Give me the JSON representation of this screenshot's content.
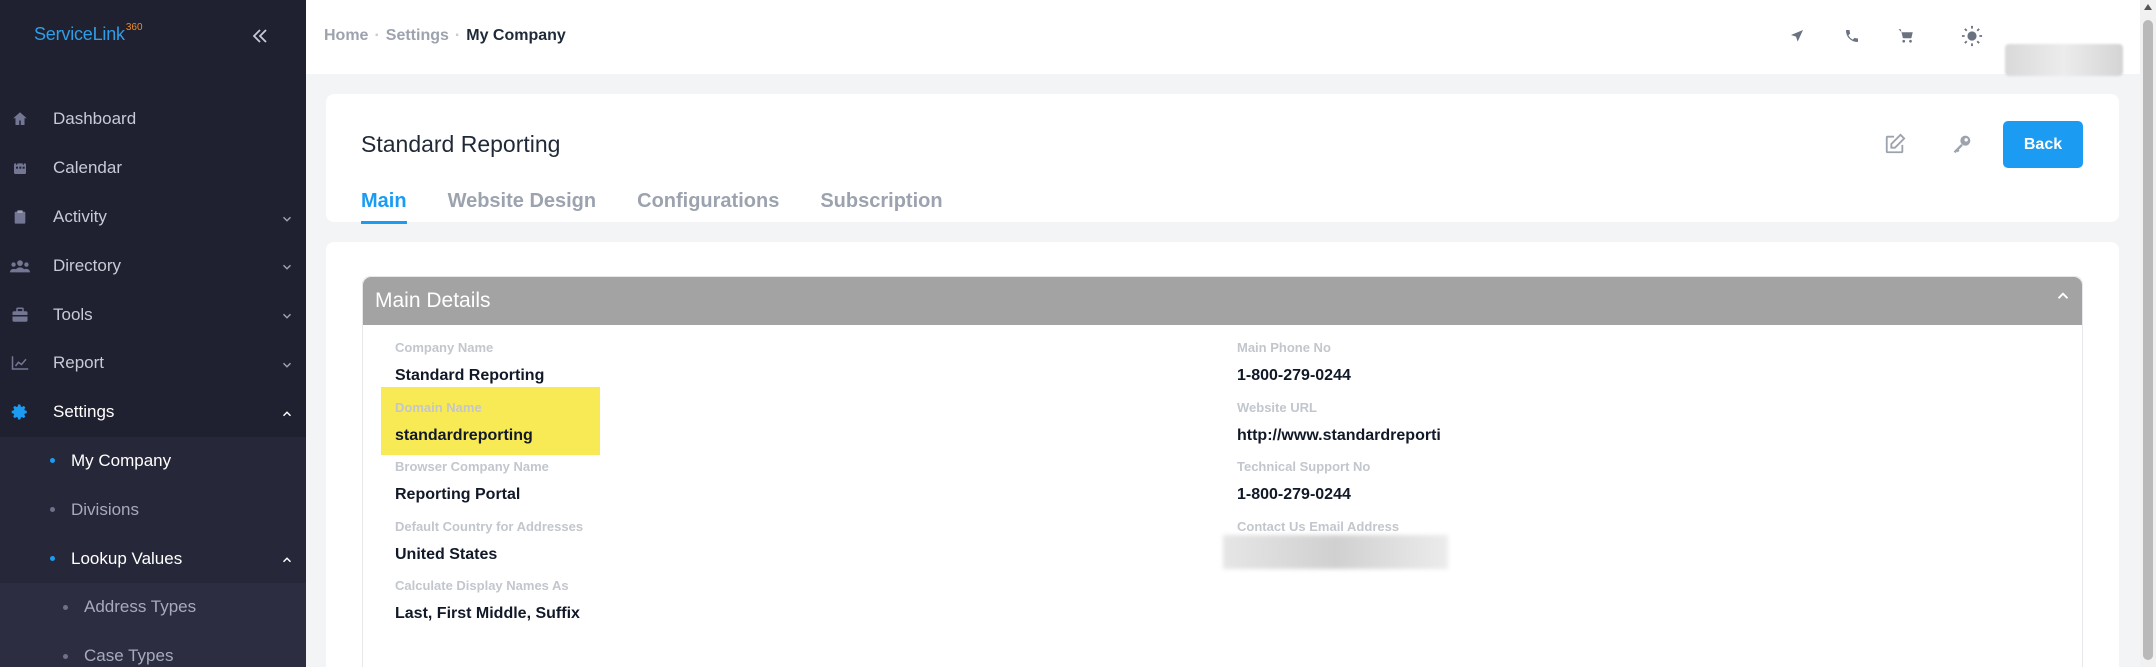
{
  "app": {
    "logo_text": "ServiceLink",
    "logo_sup": "360"
  },
  "sidebar": {
    "items": [
      {
        "label": "Dashboard",
        "icon": "home-icon"
      },
      {
        "label": "Calendar",
        "icon": "calendar-icon"
      },
      {
        "label": "Activity",
        "icon": "clipboard-icon"
      },
      {
        "label": "Directory",
        "icon": "users-icon"
      },
      {
        "label": "Tools",
        "icon": "toolbox-icon"
      },
      {
        "label": "Report",
        "icon": "chart-icon"
      },
      {
        "label": "Settings",
        "icon": "gear-icon"
      }
    ],
    "settings_children": [
      {
        "label": "My Company"
      },
      {
        "label": "Divisions"
      },
      {
        "label": "Lookup Values"
      }
    ],
    "lookup_children": [
      {
        "label": "Address Types"
      },
      {
        "label": "Case Types"
      }
    ]
  },
  "breadcrumb": {
    "home": "Home",
    "settings": "Settings",
    "current": "My Company"
  },
  "header": {
    "title": "Standard Reporting",
    "back_label": "Back",
    "tabs": [
      {
        "label": "Main"
      },
      {
        "label": "Website Design"
      },
      {
        "label": "Configurations"
      },
      {
        "label": "Subscription"
      }
    ]
  },
  "main_details": {
    "title": "Main Details",
    "left": [
      {
        "label": "Company Name",
        "value": "Standard Reporting"
      },
      {
        "label": "Domain Name",
        "value": "standardreporting"
      },
      {
        "label": "Browser Company Name",
        "value": "Reporting Portal"
      },
      {
        "label": "Default Country for Addresses",
        "value": "United States"
      },
      {
        "label": "Calculate Display Names As",
        "value": "Last, First Middle, Suffix"
      }
    ],
    "right": [
      {
        "label": "Main Phone No",
        "value": "1-800-279-0244"
      },
      {
        "label": "Website URL",
        "value": "http://www.standardreporti"
      },
      {
        "label": "Technical Support No",
        "value": "1-800-279-0244"
      },
      {
        "label": "Contact Us Email Address",
        "value": ""
      }
    ]
  },
  "colors": {
    "accent": "#1b9cf2",
    "sidebar_bg": "#1f2030",
    "highlight": "#f8ea55",
    "panel_header": "#a3a3a3"
  }
}
